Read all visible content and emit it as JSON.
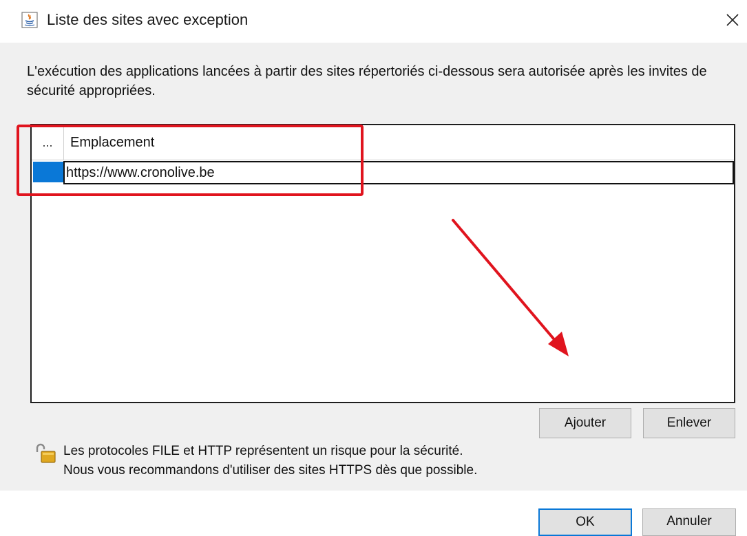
{
  "window": {
    "title": "Liste des sites avec exception",
    "app_icon": "java-icon",
    "close_glyph": "✕"
  },
  "description": "L'exécution des applications lancées à partir des sites répertoriés ci-dessous sera autorisée après les invites de sécurité appropriées.",
  "table": {
    "columns": [
      "...",
      "Emplacement"
    ],
    "rows": [
      {
        "location": "https://www.cronolive.be"
      }
    ]
  },
  "buttons": {
    "add": "Ajouter",
    "remove": "Enlever",
    "ok": "OK",
    "cancel": "Annuler"
  },
  "warning": {
    "icon": "unlocked-padlock-icon",
    "line1": "Les protocoles FILE et HTTP représentent un risque pour la sécurité.",
    "line2": "Nous vous recommandons d'utiliser des sites HTTPS dès que possible."
  },
  "colors": {
    "annotation_red": "#e0141e",
    "selection_blue": "#0a78d7",
    "dialog_bg": "#f0f0f0"
  }
}
